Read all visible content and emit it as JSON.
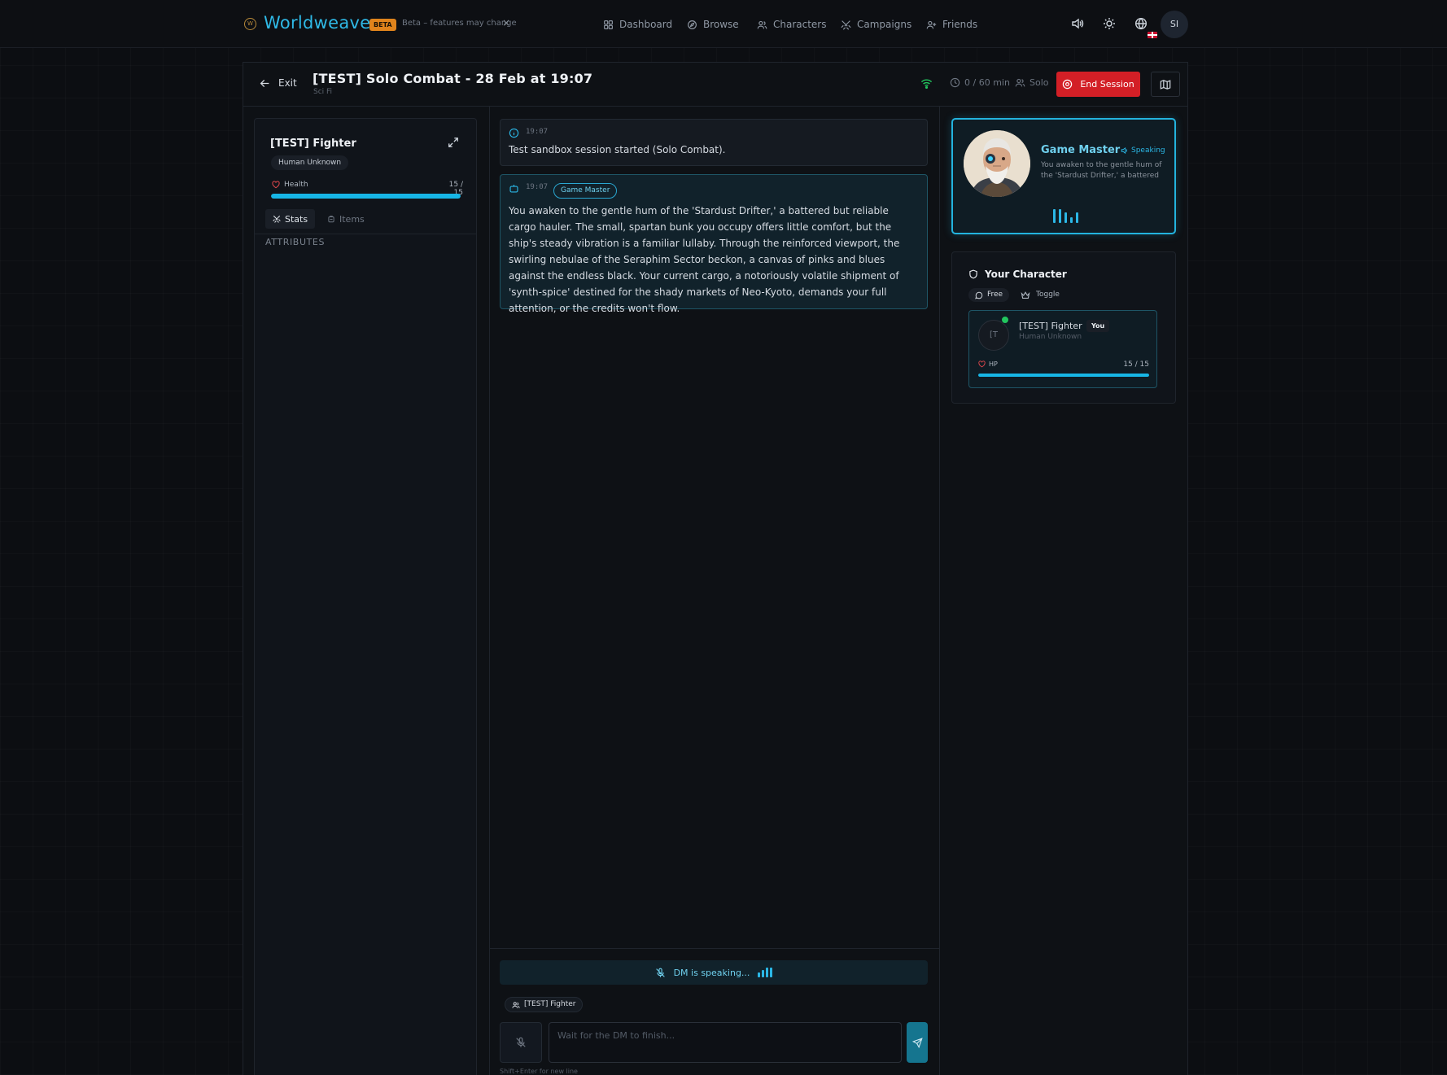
{
  "nav": {
    "logo_letter": "W",
    "brand": "Worldweave",
    "beta_badge": "BETA",
    "beta_note": "Beta – features may change",
    "beta_close": "×",
    "items": [
      {
        "label": "Dashboard",
        "icon": "grid-icon"
      },
      {
        "label": "Browse",
        "icon": "compass-icon"
      },
      {
        "label": "Characters",
        "icon": "users-icon"
      },
      {
        "label": "Campaigns",
        "icon": "swords-icon"
      },
      {
        "label": "Friends",
        "icon": "user-plus-icon"
      }
    ],
    "avatar_initials": "SI"
  },
  "session": {
    "exit_label": "Exit",
    "title": "[TEST] Solo Combat - 28 Feb at 19:07",
    "genre": "Sci Fi",
    "timer": "0 / 60 min",
    "mode": "Solo",
    "end_label": "End Session"
  },
  "character_panel": {
    "name": "[TEST] Fighter",
    "race": "Human Unknown",
    "health_label": "Health",
    "health_value": "15 / 15",
    "health_fraction": 1.0,
    "tabs": {
      "stats": "Stats",
      "items": "Items"
    },
    "attributes_heading": "ATTRIBUTES"
  },
  "chat": {
    "messages": [
      {
        "time": "19:07",
        "text": "Test sandbox session started (Solo Combat)."
      },
      {
        "time": "19:07",
        "speaker": "Game Master",
        "text": "You awaken to the gentle hum of the 'Stardust Drifter,' a battered but reliable cargo hauler. The small, spartan bunk you occupy offers little comfort, but the ship's steady vibration is a familiar lullaby. Through the reinforced viewport, the swirling nebulae of the Seraphim Sector beckon, a canvas of pinks and blues against the endless black. Your current cargo, a notoriously volatile shipment of 'synth-spice' destined for the shady markets of Neo-Kyoto, demands your full attention, or the credits won't flow."
      }
    ],
    "dm_status": "DM is speaking...",
    "speaker_chip": "[TEST] Fighter",
    "input_placeholder": "Wait for the DM to finish...",
    "hint": "Shift+Enter for new line"
  },
  "gm_card": {
    "name": "Game Master",
    "status": "Speaking",
    "preview": "You awaken to the gentle hum of the 'Stardust Drifter,' a battered b..."
  },
  "your_character": {
    "heading": "Your Character",
    "mode_free": "Free",
    "mode_toggle": "Toggle",
    "avatar_initials": "[T",
    "name": "[TEST] Fighter",
    "you_badge": "You",
    "race": "Human Unknown",
    "hp_label": "HP",
    "hp_value": "15 / 15",
    "hp_fraction": 1.0
  },
  "colors": {
    "accent": "#17b6e6",
    "danger": "#d31f26",
    "beta": "#e0841c",
    "online": "#22c55e"
  }
}
